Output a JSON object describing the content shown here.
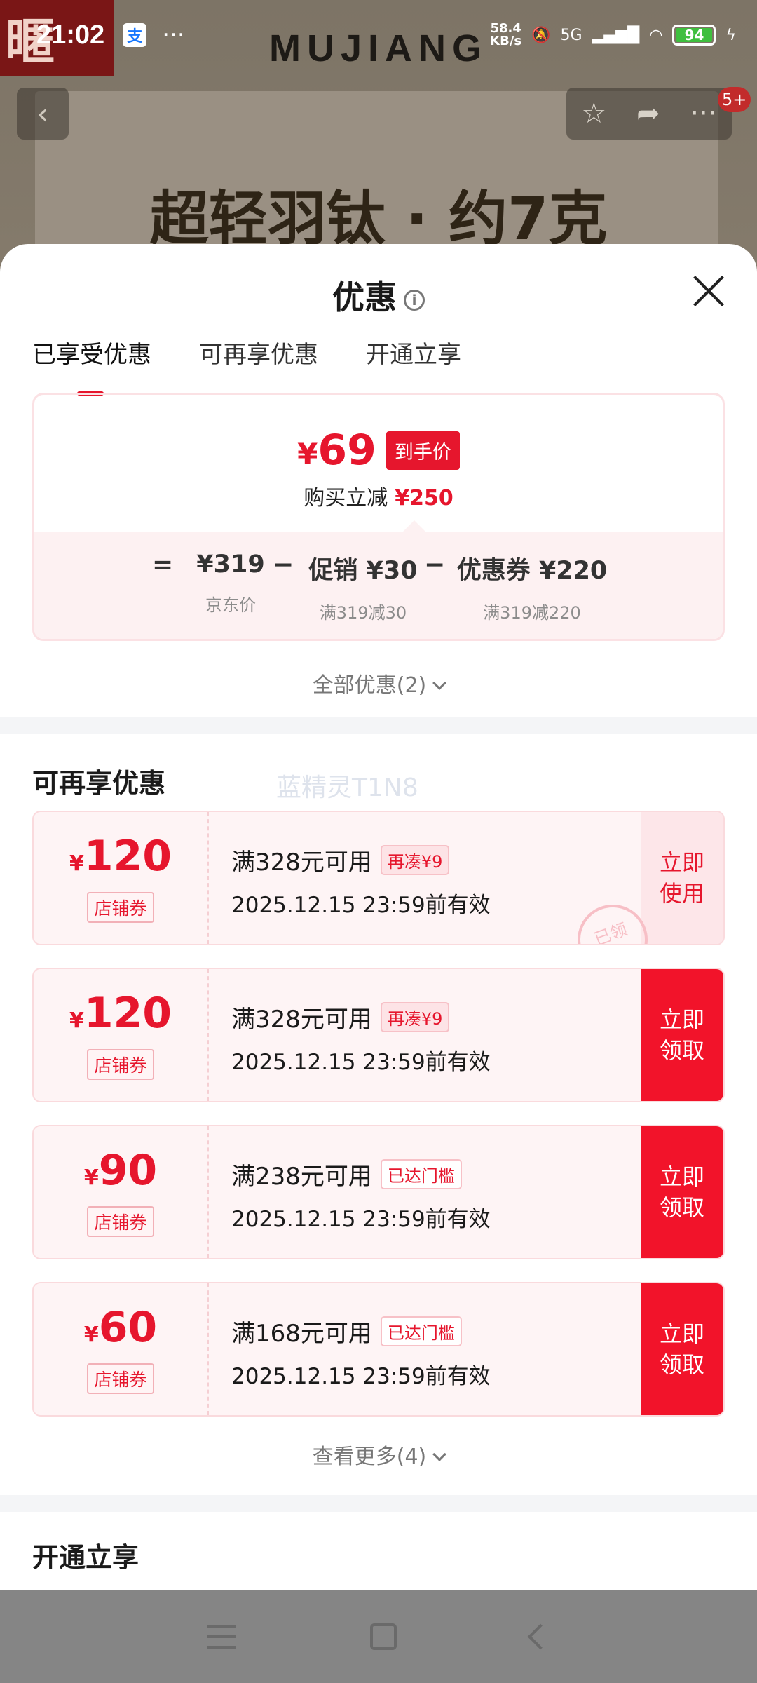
{
  "status_bar": {
    "time": "21:02",
    "net_speed_value": "58.4",
    "net_speed_unit": "KB/s",
    "network": "5G",
    "battery": "94"
  },
  "background": {
    "app_icon_text": "暱",
    "brand": "MUJIANG",
    "slogan": "超轻羽钛 · 约7克",
    "badge": "5+"
  },
  "sheet": {
    "title": "优惠",
    "tabs": [
      {
        "label": "已享受优惠",
        "active": true
      },
      {
        "label": "可再享优惠",
        "active": false
      },
      {
        "label": "开通立享",
        "active": false
      }
    ],
    "summary": {
      "currency": "¥",
      "final_price": "69",
      "final_tag": "到手价",
      "save_label": "购买立减",
      "save_amount": "¥250",
      "equals": "=",
      "base_price": "¥319",
      "base_sub": "京东价",
      "minus1": "−",
      "promo": "促销 ¥30",
      "promo_sub": "满319减30",
      "minus2": "−",
      "coupon": "优惠券 ¥220",
      "coupon_sub": "满319减220"
    },
    "all_offers": "全部优惠(2)",
    "section_title": "可再享优惠",
    "watermark": "蓝精灵T1N8",
    "coupons": [
      {
        "currency": "¥",
        "amount": "120",
        "type": "店铺券",
        "condition": "满328元可用",
        "tag": "再凑¥9",
        "date": "2025.12.15 23:59前有效",
        "btn_line1": "立即",
        "btn_line2": "使用",
        "stamp": "已领"
      },
      {
        "currency": "¥",
        "amount": "120",
        "type": "店铺券",
        "condition": "满328元可用",
        "tag": "再凑¥9",
        "date": "2025.12.15 23:59前有效",
        "btn_line1": "立即",
        "btn_line2": "领取"
      },
      {
        "currency": "¥",
        "amount": "90",
        "type": "店铺券",
        "condition": "满238元可用",
        "tag": "已达门槛",
        "date": "2025.12.15 23:59前有效",
        "btn_line1": "立即",
        "btn_line2": "领取"
      },
      {
        "currency": "¥",
        "amount": "60",
        "type": "店铺券",
        "condition": "满168元可用",
        "tag": "已达门槛",
        "date": "2025.12.15 23:59前有效",
        "btn_line1": "立即",
        "btn_line2": "领取"
      }
    ],
    "see_more": "查看更多(4)",
    "next_section": "开通立享"
  },
  "colors": {
    "accent_red": "#e6162d",
    "button_red": "#f2132a"
  },
  "icons": [
    "info-icon",
    "close-icon",
    "chevron-down-icon",
    "back-icon",
    "star-icon",
    "share-icon",
    "more-icon",
    "menu-icon",
    "home-icon"
  ]
}
